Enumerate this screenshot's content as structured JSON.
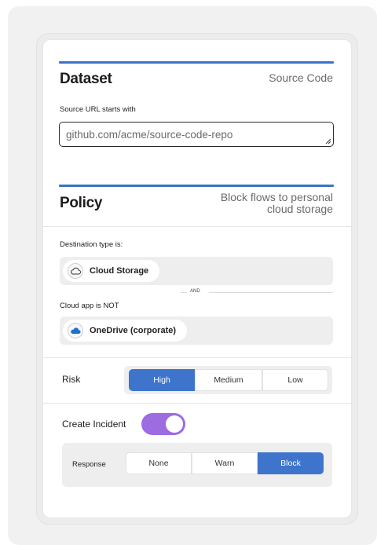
{
  "dataset": {
    "title": "Dataset",
    "value": "Source Code",
    "source_url_label": "Source URL starts with",
    "source_url_value": "github.com/acme/source-code-repo"
  },
  "policy": {
    "title": "Policy",
    "description_line1": "Block flows to personal",
    "description_line2": "cloud storage",
    "destination_label": "Destination type is:",
    "destination_value": "Cloud Storage",
    "and_label": "AND",
    "cloud_app_label": "Cloud app is NOT",
    "cloud_app_value": "OneDrive (corporate)"
  },
  "risk": {
    "label": "Risk",
    "options": [
      "High",
      "Medium",
      "Low"
    ],
    "selected": "High"
  },
  "incident": {
    "label": "Create Incident",
    "enabled": true,
    "response_label": "Response",
    "response_options": [
      "None",
      "Warn",
      "Block"
    ],
    "response_selected": "Block"
  },
  "colors": {
    "accent": "#3a72c8",
    "toggle": "#9d6ce0",
    "onedrive": "#1b6fd1"
  }
}
